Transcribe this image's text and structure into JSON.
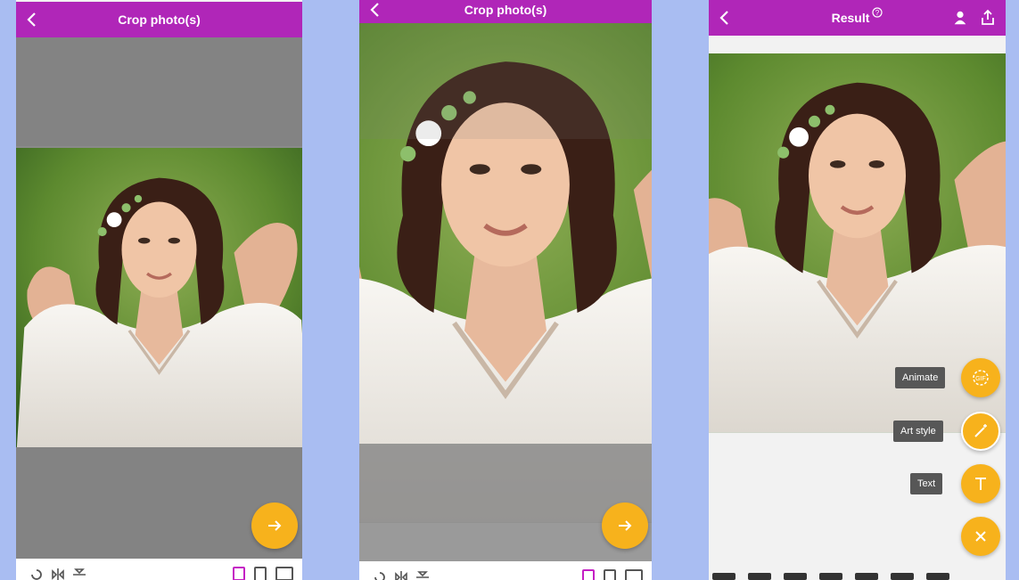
{
  "screens": {
    "crop1": {
      "title": "Crop photo(s)"
    },
    "crop2": {
      "title": "Crop photo(s)"
    },
    "result": {
      "title": "Result",
      "actions": {
        "animate": "Animate",
        "art_style": "Art style",
        "text": "Text"
      }
    }
  },
  "icons": {
    "back": "chevron-left-icon",
    "next": "arrow-right-icon",
    "help": "help-icon",
    "person": "person-icon",
    "share": "share-icon",
    "gif": "gif-icon",
    "magic": "magic-wand-icon",
    "text": "text-icon",
    "close": "close-icon"
  },
  "colors": {
    "appbar": "#b026b8",
    "accent": "#f7b21c",
    "background": "#a9bdf2",
    "selected_ratio": "#c41fc4"
  }
}
